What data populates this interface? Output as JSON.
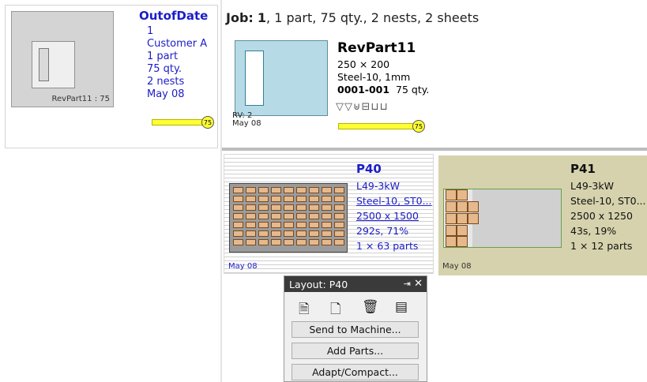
{
  "job_card": {
    "title": "OutofDate",
    "thumb_caption": "RevPart11 : 75",
    "lines": [
      "1",
      "Customer A",
      "1 part",
      "75 qty.",
      "2 nests",
      "May 08"
    ],
    "progress_value": "75",
    "progress_fraction": 1.0
  },
  "job_header": {
    "label": "Job:",
    "number": "1",
    "summary": ", 1 part, 75 qty., 2 nests, 2 sheets"
  },
  "part": {
    "name": "RevPart11",
    "size": "250 × 200",
    "material": "Steel-10, 1mm",
    "code": "0001-001",
    "qty": "75 qty.",
    "rv_label": "RV: 2",
    "date": "May 08",
    "icons": [
      "nest-icon",
      "nest-icon",
      "cut-icon",
      "sheet-icon",
      "sheet-icon",
      "sheet-icon"
    ],
    "progress_value": "75",
    "progress_fraction": 1.0
  },
  "nests": [
    {
      "name": "P40",
      "machine": "L49-3kW",
      "material": "Steel-10, ST0...",
      "sheet_size": "2500 x 1500",
      "time_util": "292s, 71%",
      "parts": "1 × 63 parts",
      "date": "May 08",
      "accent_color": "#1c1cc8"
    },
    {
      "name": "P41",
      "machine": "L49-3kW",
      "material": "Steel-10, ST0...",
      "sheet_size": "2500 x 1250",
      "time_util": "43s, 19%",
      "parts": "1 × 12 parts",
      "date": "May 08",
      "background_color": "#d6d2ad"
    }
  ],
  "layout_panel": {
    "title_prefix": "Layout:",
    "title_value": "P40",
    "pin_glyph": "⇥",
    "close_glyph": "✕",
    "toolbar": [
      {
        "icon": "document-icon",
        "glyph": "🗎"
      },
      {
        "icon": "edit-document-icon",
        "glyph": "🗋"
      },
      {
        "icon": "delete-icon",
        "glyph": "🗑"
      },
      {
        "icon": "report-icon",
        "glyph": "▤"
      }
    ],
    "buttons": [
      "Send to Machine...",
      "Add Parts...",
      "Adapt/Compact..."
    ]
  }
}
